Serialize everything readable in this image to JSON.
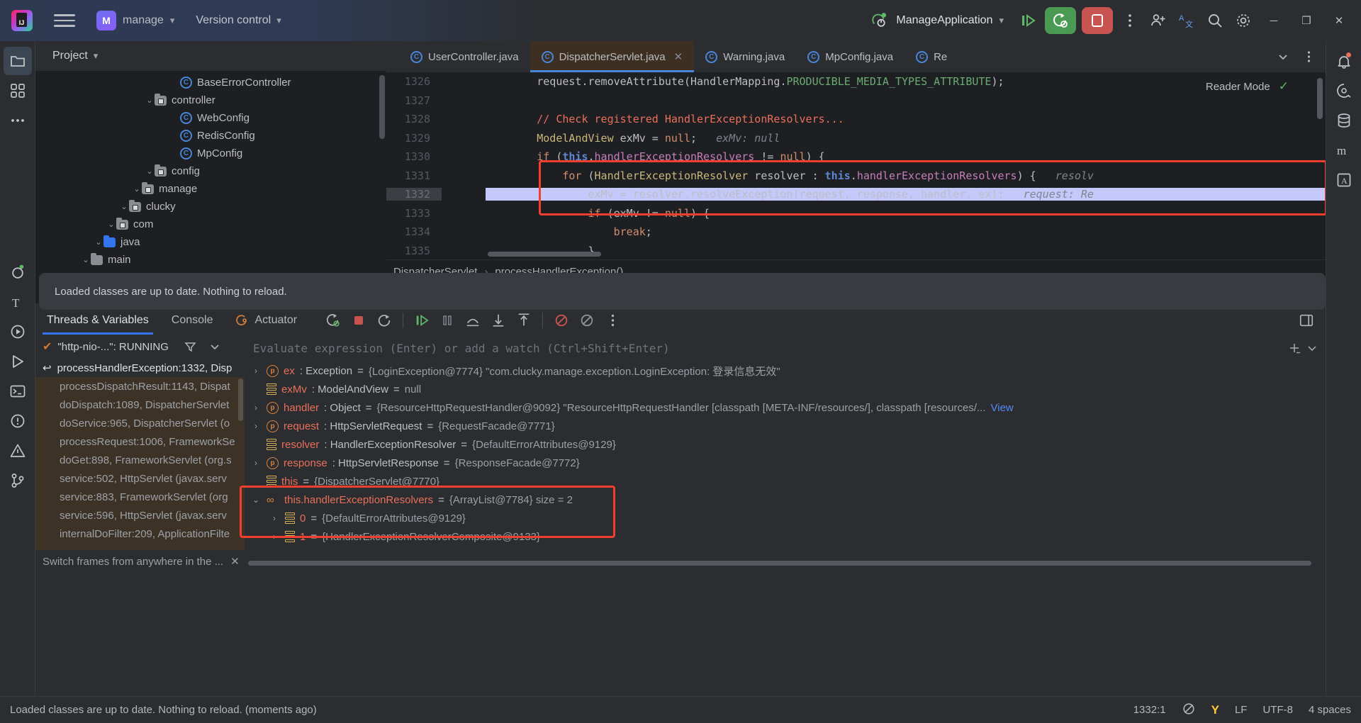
{
  "titlebar": {
    "menu_icon": "hamburger-icon",
    "project_badge": "M",
    "project_name": "manage",
    "vcs_label": "Version control",
    "run_config": "ManageApplication",
    "logo_text": "IJ",
    "buttons": {
      "resume": "resume-icon",
      "rerun_debug": "rerun-debug-icon",
      "stop": "stop-icon",
      "more": "more-vertical-icon",
      "add_user": "add-user-icon",
      "translate": "translate-icon",
      "search": "search-icon",
      "settings": "settings-icon",
      "minimize": "─",
      "maximize": "❐",
      "close": "✕"
    }
  },
  "left_rail": [
    "project-icon",
    "structure-icon",
    "more-dots-icon",
    "bean-icon",
    "terminal-type-icon",
    "run-icon",
    "play-icon",
    "terminal-icon",
    "problems-icon",
    "warning-icon",
    "git-icon"
  ],
  "right_rail": [
    "notifications-icon",
    "ai-icon",
    "database-icon",
    "maven-icon",
    "ui-icon"
  ],
  "project_panel": {
    "title": "Project",
    "tree": [
      {
        "label": "main",
        "indent": 3,
        "arrow": "⌄",
        "icon": "folder-gray"
      },
      {
        "label": "java",
        "indent": 4,
        "arrow": "⌄",
        "icon": "folder-blue"
      },
      {
        "label": "com",
        "indent": 5,
        "arrow": "⌄",
        "icon": "folder-pkg"
      },
      {
        "label": "clucky",
        "indent": 6,
        "arrow": "⌄",
        "icon": "folder-pkg"
      },
      {
        "label": "manage",
        "indent": 7,
        "arrow": "⌄",
        "icon": "folder-pkg"
      },
      {
        "label": "config",
        "indent": 8,
        "arrow": "⌄",
        "icon": "folder-pkg"
      },
      {
        "label": "MpConfig",
        "indent": 10,
        "arrow": "",
        "icon": "class"
      },
      {
        "label": "RedisConfig",
        "indent": 10,
        "arrow": "",
        "icon": "class"
      },
      {
        "label": "WebConfig",
        "indent": 10,
        "arrow": "",
        "icon": "class"
      },
      {
        "label": "controller",
        "indent": 8,
        "arrow": "⌄",
        "icon": "folder-pkg"
      },
      {
        "label": "BaseErrorController",
        "indent": 10,
        "arrow": "",
        "icon": "class"
      }
    ]
  },
  "editor": {
    "tabs": [
      {
        "label": "UserController.java",
        "active": false,
        "closable": false
      },
      {
        "label": "DispatcherServlet.java",
        "active": true,
        "closable": true
      },
      {
        "label": "Warning.java",
        "active": false,
        "closable": false
      },
      {
        "label": "MpConfig.java",
        "active": false,
        "closable": false
      },
      {
        "label": "Re",
        "active": false,
        "closable": false
      }
    ],
    "tab_overflow_icon": "chevron-down-icon",
    "tab_more_icon": "more-vertical-icon",
    "reader_mode": "Reader Mode",
    "lines": [
      {
        "n": "1326",
        "exec": false,
        "parts": [
          {
            "t": "        ",
            "c": "plain"
          },
          {
            "t": "request",
            "c": "plain"
          },
          {
            "t": ".",
            "c": "plain"
          },
          {
            "t": "removeAttribute",
            "c": "plain"
          },
          {
            "t": "(",
            "c": "plain"
          },
          {
            "t": "HandlerMapping",
            "c": "plain"
          },
          {
            "t": ".",
            "c": "plain"
          },
          {
            "t": "PRODUCIBLE_MEDIA_TYPES_ATTRIBUTE",
            "c": "str"
          },
          {
            "t": ");",
            "c": "plain"
          }
        ]
      },
      {
        "n": "1327",
        "exec": false,
        "parts": []
      },
      {
        "n": "1328",
        "exec": false,
        "parts": [
          {
            "t": "        ",
            "c": "plain"
          },
          {
            "t": "// Check registered HandlerExceptionResolvers...",
            "c": "com"
          }
        ]
      },
      {
        "n": "1329",
        "exec": false,
        "parts": [
          {
            "t": "        ",
            "c": "plain"
          },
          {
            "t": "ModelAndView",
            "c": "cls-n"
          },
          {
            "t": " exMv = ",
            "c": "plain"
          },
          {
            "t": "null",
            "c": "kw"
          },
          {
            "t": ";   ",
            "c": "plain"
          },
          {
            "t": "exMv: null",
            "c": "hint"
          }
        ]
      },
      {
        "n": "1330",
        "exec": false,
        "parts": [
          {
            "t": "        ",
            "c": "plain"
          },
          {
            "t": "if",
            "c": "kw"
          },
          {
            "t": " (",
            "c": "plain"
          },
          {
            "t": "this",
            "c": "kw2"
          },
          {
            "t": ".",
            "c": "plain"
          },
          {
            "t": "handlerExceptionResolvers",
            "c": "fld"
          },
          {
            "t": " != ",
            "c": "plain"
          },
          {
            "t": "null",
            "c": "kw"
          },
          {
            "t": ") {",
            "c": "plain"
          }
        ]
      },
      {
        "n": "1331",
        "exec": false,
        "parts": [
          {
            "t": "            ",
            "c": "plain"
          },
          {
            "t": "for",
            "c": "kw"
          },
          {
            "t": " (",
            "c": "plain"
          },
          {
            "t": "HandlerExceptionResolver",
            "c": "cls-n"
          },
          {
            "t": " resolver : ",
            "c": "plain"
          },
          {
            "t": "this",
            "c": "kw2"
          },
          {
            "t": ".",
            "c": "plain"
          },
          {
            "t": "handlerExceptionResolvers",
            "c": "fld"
          },
          {
            "t": ") {   ",
            "c": "plain"
          },
          {
            "t": "resolv",
            "c": "hint"
          }
        ]
      },
      {
        "n": "1332",
        "exec": true,
        "parts": [
          {
            "t": "                exMv = resolver.resolveException(request, response, handler, ex);   ",
            "c": "plain"
          },
          {
            "t": "request: Re",
            "c": "hint"
          }
        ]
      },
      {
        "n": "1333",
        "exec": false,
        "parts": [
          {
            "t": "                ",
            "c": "plain"
          },
          {
            "t": "if",
            "c": "kw"
          },
          {
            "t": " (exMv != ",
            "c": "plain"
          },
          {
            "t": "null",
            "c": "kw"
          },
          {
            "t": ") {",
            "c": "plain"
          }
        ]
      },
      {
        "n": "1334",
        "exec": false,
        "parts": [
          {
            "t": "                    ",
            "c": "plain"
          },
          {
            "t": "break",
            "c": "kw"
          },
          {
            "t": ";",
            "c": "plain"
          }
        ]
      },
      {
        "n": "1335",
        "exec": false,
        "parts": [
          {
            "t": "                }",
            "c": "plain"
          }
        ]
      }
    ],
    "breadcrumb": [
      "DispatcherServlet",
      "processHandlerException()"
    ]
  },
  "balloon": {
    "text": "Loaded classes are up to date. Nothing to reload."
  },
  "debug": {
    "tabs": [
      {
        "label": "Threads & Variables",
        "active": true,
        "icon": null
      },
      {
        "label": "Console",
        "active": false,
        "icon": null
      },
      {
        "label": "Actuator",
        "active": false,
        "icon": "actuator-icon"
      }
    ],
    "tools": [
      "rerun-debug-icon",
      "stop-icon",
      "restart-icon",
      "resume-icon",
      "pause-icon",
      "step-over-icon",
      "step-into-icon",
      "step-out-icon",
      "mute-breakpoints-icon",
      "view-breakpoints-icon",
      "more-vertical-icon"
    ],
    "layout_icon": "layout-settings-icon",
    "thread": "\"http-nio-...\": RUNNING",
    "filter_icon": "filter-icon",
    "thread_chevron": "chevron-down-icon",
    "frames": [
      {
        "label": "processHandlerException:1332, Disp",
        "selected": true
      },
      {
        "label": "processDispatchResult:1143, Dispat",
        "selected": false
      },
      {
        "label": "doDispatch:1089, DispatcherServlet",
        "selected": false
      },
      {
        "label": "doService:965, DispatcherServlet (o",
        "selected": false
      },
      {
        "label": "processRequest:1006, FrameworkSe",
        "selected": false
      },
      {
        "label": "doGet:898, FrameworkServlet (org.s",
        "selected": false
      },
      {
        "label": "service:502, HttpServlet (javax.serv",
        "selected": false
      },
      {
        "label": "service:883, FrameworkServlet (org",
        "selected": false
      },
      {
        "label": "service:596, HttpServlet (javax.serv",
        "selected": false
      },
      {
        "label": "internalDoFilter:209, ApplicationFilte",
        "selected": false
      }
    ],
    "watch_placeholder": "Evaluate expression (Enter) or add a watch (Ctrl+Shift+Enter)",
    "watch_add_icon": "add-watch-icon",
    "watch_chevron_icon": "chevron-down-icon",
    "variables": [
      {
        "arrow": "›",
        "icon": "param",
        "name": "ex",
        "type": ": Exception",
        "eq": "=",
        "value": "{LoginException@7774} \"com.clucky.manage.exception.LoginException: 登录信息无效\"",
        "indent": 0,
        "link": ""
      },
      {
        "arrow": "",
        "icon": "stack",
        "name": "exMv",
        "type": ": ModelAndView",
        "eq": "=",
        "value": "null",
        "indent": 0,
        "link": ""
      },
      {
        "arrow": "›",
        "icon": "param",
        "name": "handler",
        "type": ": Object",
        "eq": "=",
        "value": "{ResourceHttpRequestHandler@9092} \"ResourceHttpRequestHandler [classpath [META-INF/resources/], classpath [resources/...",
        "indent": 0,
        "link": "View"
      },
      {
        "arrow": "›",
        "icon": "param",
        "name": "request",
        "type": ": HttpServletRequest",
        "eq": "=",
        "value": "{RequestFacade@7771}",
        "indent": 0,
        "link": ""
      },
      {
        "arrow": "",
        "icon": "stack",
        "name": "resolver",
        "type": ": HandlerExceptionResolver",
        "eq": "=",
        "value": "{DefaultErrorAttributes@9129}",
        "indent": 0,
        "link": ""
      },
      {
        "arrow": "›",
        "icon": "param",
        "name": "response",
        "type": ": HttpServletResponse",
        "eq": "=",
        "value": "{ResponseFacade@7772}",
        "indent": 0,
        "link": ""
      },
      {
        "arrow": "",
        "icon": "stack",
        "name": "this",
        "type": "",
        "eq": "=",
        "value": "{DispatcherServlet@7770}",
        "indent": 0,
        "link": ""
      },
      {
        "arrow": "⌄",
        "icon": "chain",
        "name": "this.handlerExceptionResolvers",
        "type": "",
        "eq": "=",
        "value": "{ArrayList@7784}  size = 2",
        "indent": 0,
        "link": ""
      },
      {
        "arrow": "›",
        "icon": "stack",
        "name": "0",
        "type": "",
        "eq": "=",
        "value": "{DefaultErrorAttributes@9129}",
        "indent": 1,
        "link": ""
      },
      {
        "arrow": "›",
        "icon": "stack",
        "name": "1",
        "type": "",
        "eq": "=",
        "value": "{HandlerExceptionResolverComposite@9133}",
        "indent": 1,
        "link": ""
      }
    ],
    "footer": "Switch frames from anywhere in the ...",
    "footer_close": "✕"
  },
  "status": {
    "message": "Loaded classes are up to date. Nothing to reload. (moments ago)",
    "caret": "1332:1",
    "inspect_icon": "inspection-icon",
    "yandex_icon": "Y",
    "line_sep": "LF",
    "encoding": "UTF-8",
    "indent": "4 spaces"
  },
  "colors": {
    "accent_blue": "#3574f0",
    "highlight_red": "#f03e2f",
    "exec_line": "#c5c8fa",
    "green_run": "#4a9a54",
    "red_stop": "#c75450",
    "frames_bg": "#3d3226",
    "active_tab_bg": "#3d2f22"
  }
}
